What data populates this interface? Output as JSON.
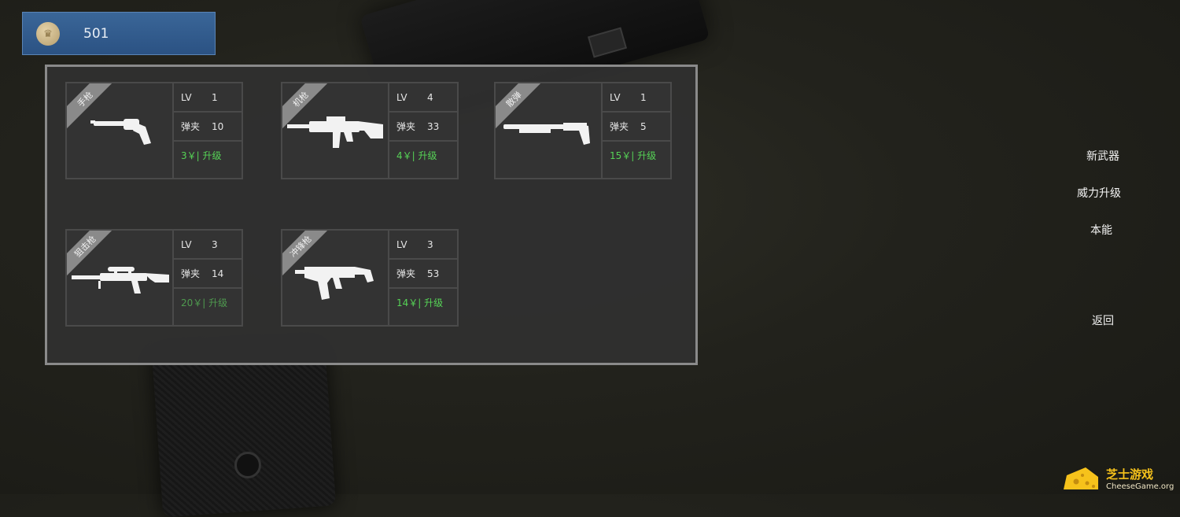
{
  "currency": {
    "icon": "crown-coin-icon",
    "value": "501"
  },
  "weapons": [
    {
      "category": "手枪",
      "icon": "revolver-icon",
      "lv_label": "LV",
      "lv": "1",
      "mag_label": "弹夹",
      "mag": "10",
      "upgrade": "3￥| 升级"
    },
    {
      "category": "机枪",
      "icon": "assault-rifle-icon",
      "lv_label": "LV",
      "lv": "4",
      "mag_label": "弹夹",
      "mag": "33",
      "upgrade": "4￥| 升级"
    },
    {
      "category": "散弹",
      "icon": "shotgun-icon",
      "lv_label": "LV",
      "lv": "1",
      "mag_label": "弹夹",
      "mag": "5",
      "upgrade": "15￥| 升级"
    },
    {
      "category": "狙击枪",
      "icon": "sniper-rifle-icon",
      "lv_label": "LV",
      "lv": "3",
      "mag_label": "弹夹",
      "mag": "14",
      "upgrade": "20￥| 升级"
    },
    {
      "category": "冲锋枪",
      "icon": "smg-icon",
      "lv_label": "LV",
      "lv": "3",
      "mag_label": "弹夹",
      "mag": "53",
      "upgrade": "14￥| 升级"
    }
  ],
  "side_menu": {
    "new_weapon": "新武器",
    "power_upgrade": "威力升级",
    "instinct": "本能",
    "back": "返回"
  },
  "watermark": {
    "title": "芝士游戏",
    "domain": "CheeseGame.org",
    "icon": "cheese-logo-icon"
  },
  "colors": {
    "upgrade_green": "#56d356",
    "currency_bar": "#2f5a8c",
    "panel_border": "#8a8a8a"
  }
}
